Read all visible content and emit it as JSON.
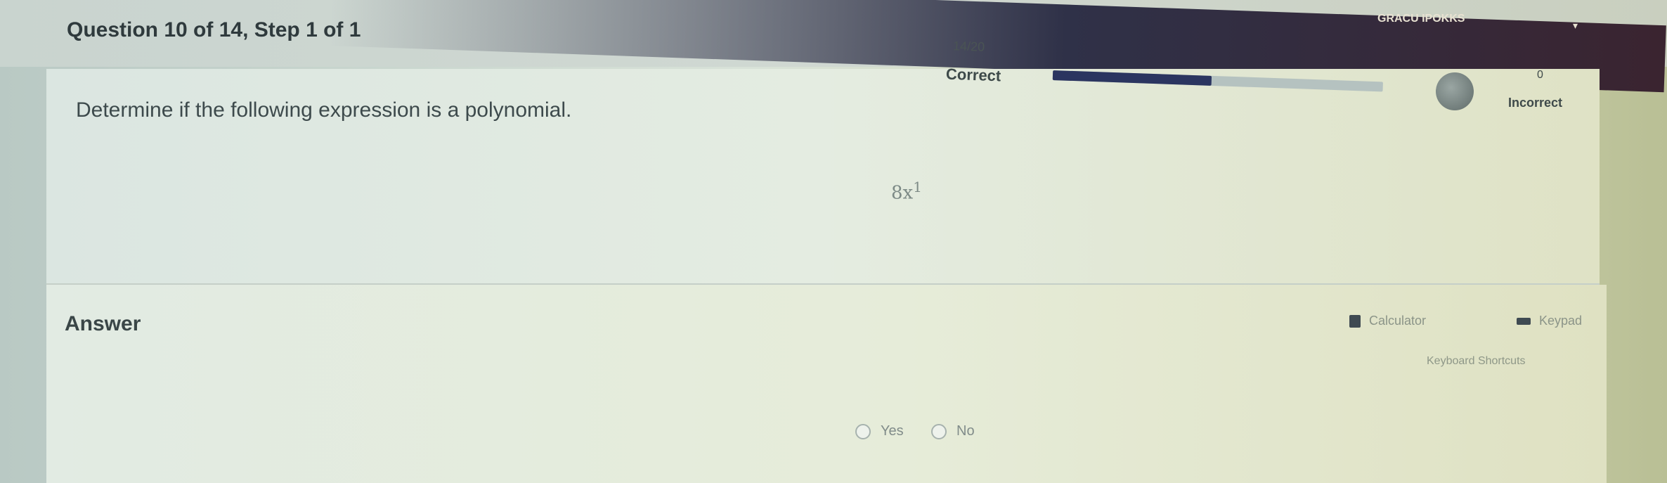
{
  "header": {
    "question_label": "Question 10 of 14,  Step 1 of 1",
    "points_badge": "GRACU IPOKKS",
    "caret": "▾",
    "score": "14/20",
    "correct_label": "Correct",
    "progress_fraction": 0.48,
    "incorrect_count": "0",
    "incorrect_label": "Incorrect"
  },
  "question": {
    "instruction": "Determine if the following expression is a polynomial.",
    "expression_base": "8x",
    "expression_exponent": "1"
  },
  "answer": {
    "title": "Answer",
    "calculator_label": "Calculator",
    "keypad_label": "Keypad",
    "shortcuts_label": "Keyboard Shortcuts",
    "options": [
      {
        "label": "Yes"
      },
      {
        "label": "No"
      }
    ]
  },
  "icons": {
    "calculator": "calculator-icon",
    "keypad": "keypad-icon",
    "radio": "radio-icon",
    "avatar": "avatar-icon",
    "caret": "chevron-down-icon"
  },
  "colors": {
    "progress_fill": "#2b3560",
    "header_dark": "#2f3148"
  }
}
